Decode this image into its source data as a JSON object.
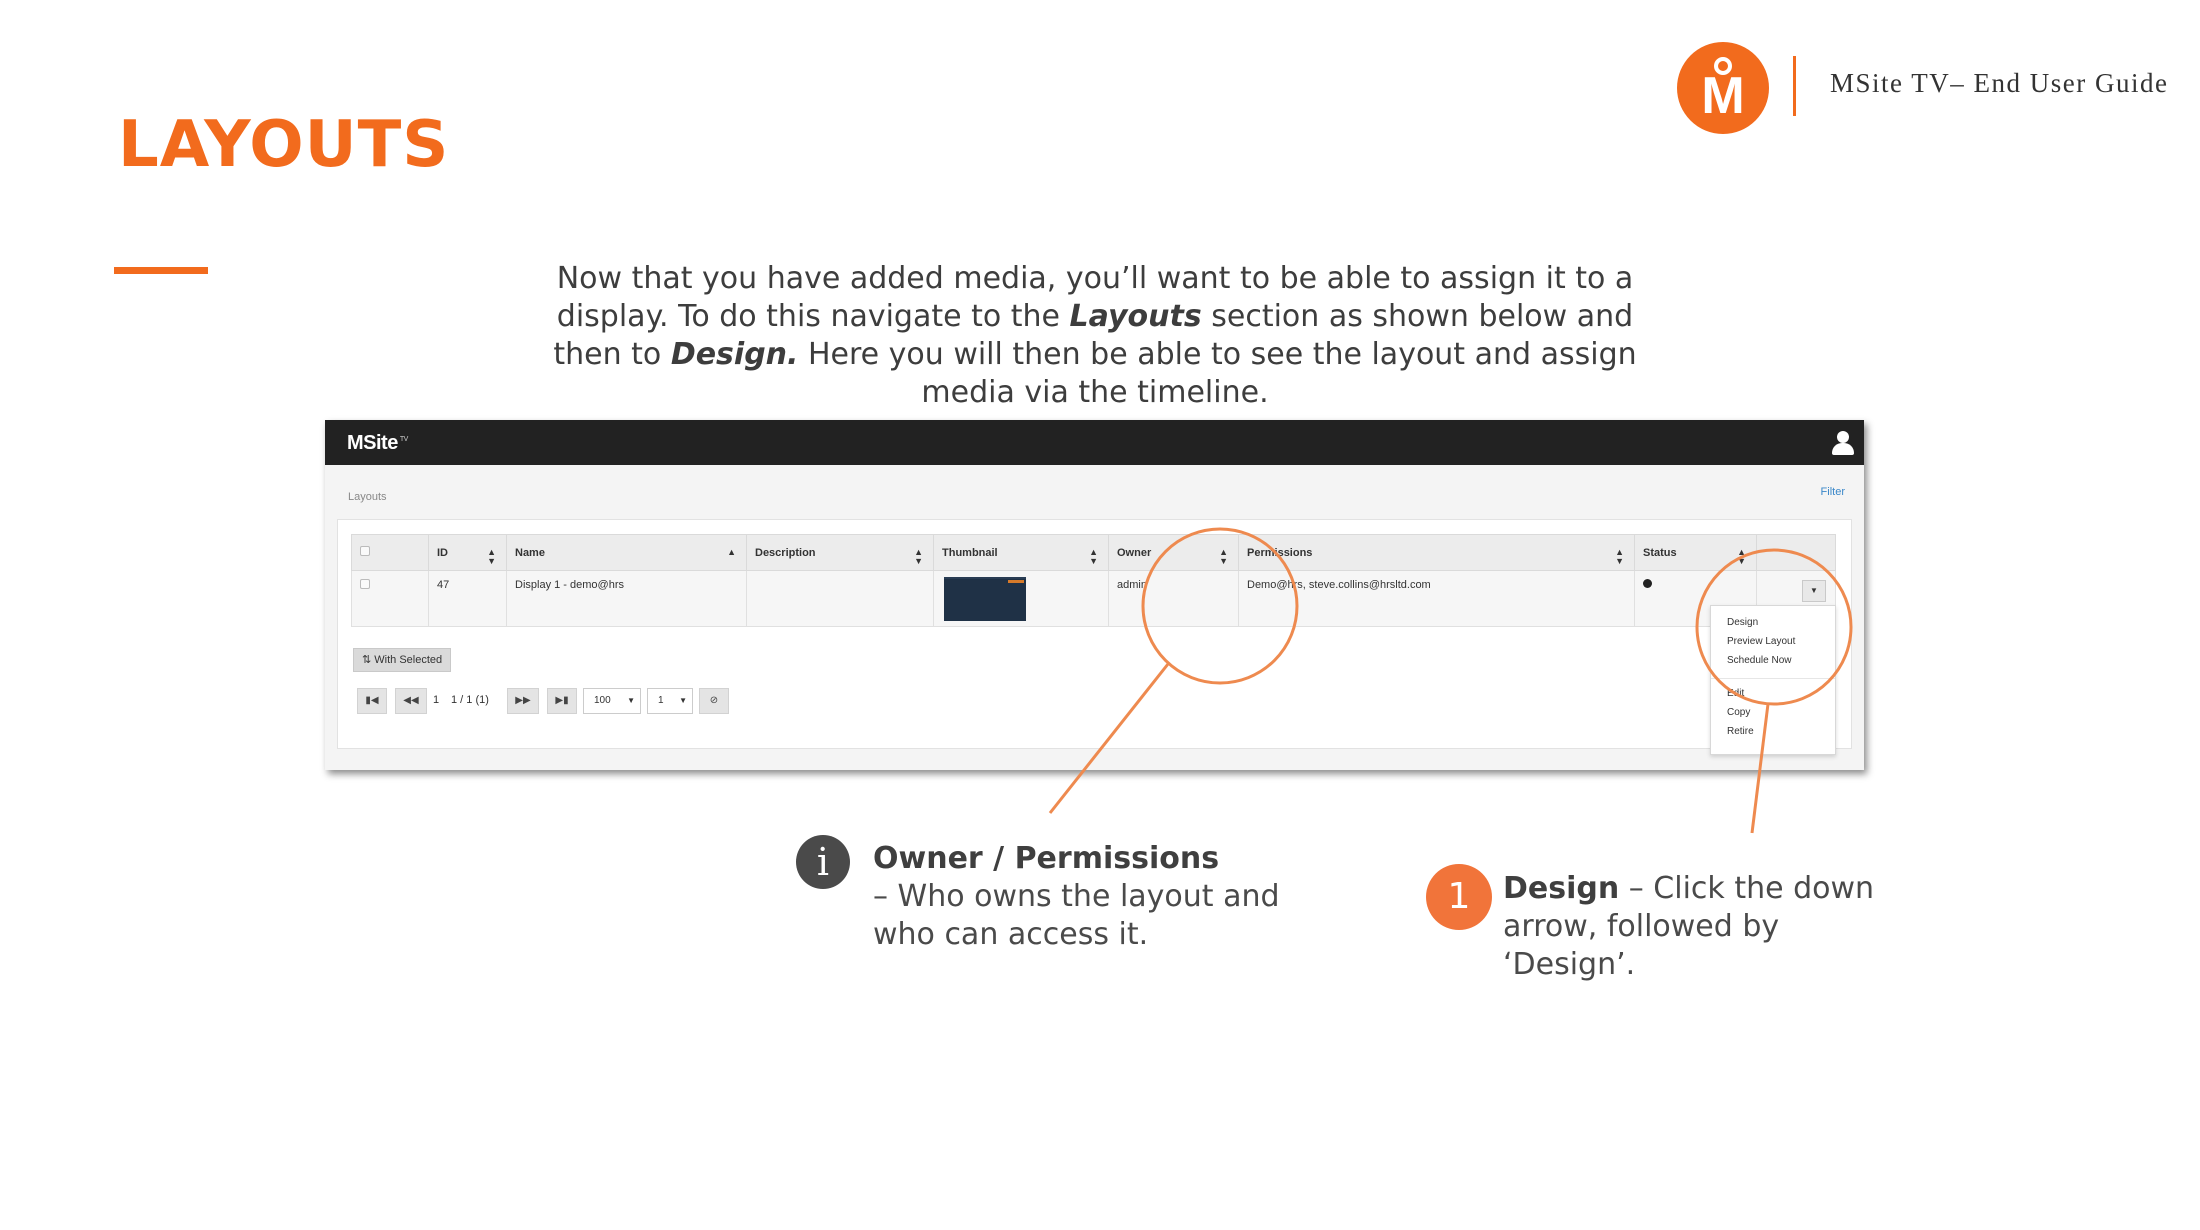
{
  "page": {
    "title": "LAYOUTS",
    "brand_letter": "M",
    "brand_caption": "MSite TV– End User Guide"
  },
  "intro": {
    "part1": "Now that you have added media, you’ll want to be able to assign it to a display. To do this navigate to the ",
    "emph1": "Layouts",
    "part2": " section as shown below and then to ",
    "emph2": "Design.",
    "part3": " Here you will then be able to see the layout and assign media via the timeline."
  },
  "app": {
    "logo": "MSite",
    "logo_sup": "TV",
    "breadcrumb": "Layouts",
    "filter_label": "Filter",
    "columns": [
      "ID",
      "Name",
      "Description",
      "Thumbnail",
      "Owner",
      "Permissions",
      "Status"
    ],
    "row": {
      "id": "47",
      "name": "Display 1 - demo@hrs",
      "description": "",
      "owner": "admin",
      "permissions": "Demo@hrs, steve.collins@hrsltd.com"
    },
    "menu_items": [
      "Design",
      "Preview Layout",
      "Schedule Now",
      "Edit",
      "Copy",
      "Retire"
    ],
    "with_selected": "With Selected",
    "pager": {
      "page": "1",
      "page_of": "1 / 1 (1)",
      "page_size": "100",
      "page_select": "1"
    },
    "icons": {
      "user": "user-icon",
      "first": "first-page-icon",
      "prev": "previous-page-icon",
      "next": "next-page-icon",
      "last": "last-page-icon",
      "refresh": "refresh-icon"
    }
  },
  "notes": {
    "owner_title": "Owner / Permissions",
    "owner_body": "– Who owns the layout and who can access it.",
    "step_number": "1",
    "design_title": "Design",
    "design_body": " – Click the down arrow, followed by ‘Design’."
  },
  "colors": {
    "accent": "#f26b1d",
    "callout_line": "#ee8a4f",
    "app_bar": "#222222",
    "text": "#4a4a4a"
  }
}
